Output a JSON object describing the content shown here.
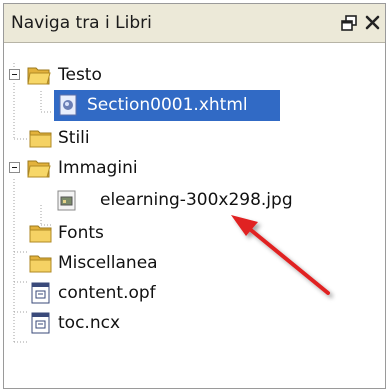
{
  "panel": {
    "title": "Naviga tra i Libri",
    "float_glyph": "🗗",
    "close_glyph": "✕"
  },
  "tree": {
    "items": [
      {
        "label": "Testo",
        "icon": "folder-open-icon",
        "expanded": true
      },
      {
        "label": "Section0001.xhtml",
        "icon": "xhtml-page-icon",
        "selected": true
      },
      {
        "label": "Stili",
        "icon": "folder-icon"
      },
      {
        "label": "Immagini",
        "icon": "folder-open-icon",
        "expanded": true
      },
      {
        "label": "elearning-300x298.jpg",
        "icon": "image-file-icon"
      },
      {
        "label": "Fonts",
        "icon": "folder-icon"
      },
      {
        "label": "Miscellanea",
        "icon": "folder-icon"
      },
      {
        "label": "content.opf",
        "icon": "opf-file-icon"
      },
      {
        "label": "toc.ncx",
        "icon": "ncx-file-icon"
      }
    ]
  },
  "colors": {
    "selection": "#316ac5",
    "folder": "#f3cc5a",
    "arrow": "#e02020"
  }
}
